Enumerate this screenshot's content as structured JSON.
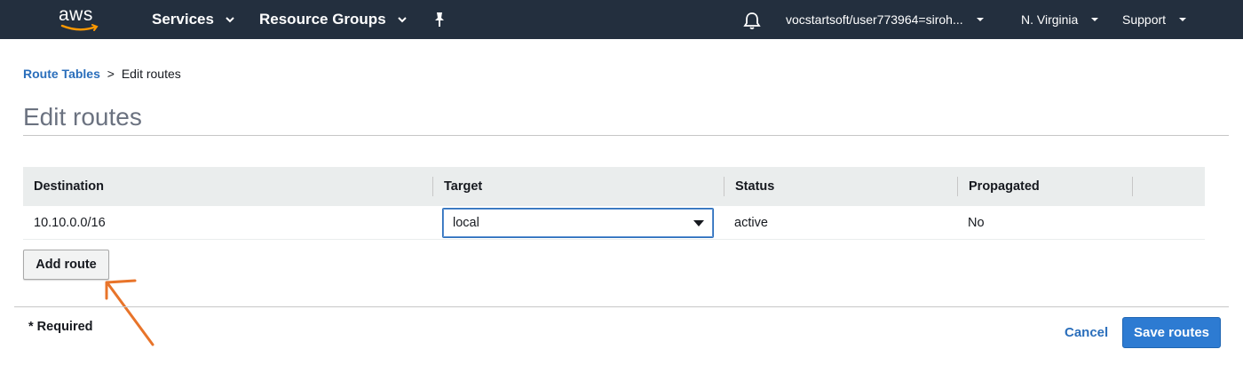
{
  "topbar": {
    "logo_text": "aws",
    "services_label": "Services",
    "resource_groups_label": "Resource Groups",
    "account_label": "vocstartsoft/user773964=siroh...",
    "region_label": "N. Virginia",
    "support_label": "Support"
  },
  "breadcrumb": {
    "parent_label": "Route Tables",
    "separator": ">",
    "current_label": "Edit routes"
  },
  "page": {
    "title": "Edit routes"
  },
  "table": {
    "columns": [
      "Destination",
      "Target",
      "Status",
      "Propagated"
    ],
    "rows": [
      {
        "destination": "10.10.0.0/16",
        "target": "local",
        "status": "active",
        "propagated": "No"
      }
    ]
  },
  "actions": {
    "add_route_label": "Add route",
    "required_note": "* Required",
    "cancel_label": "Cancel",
    "save_label": "Save routes"
  },
  "colors": {
    "topbar_bg": "#232f3e",
    "link": "#2a6ebb",
    "primary_button": "#2d7bd2",
    "annotation": "#e8742a"
  },
  "icons": [
    "aws-logo",
    "chevron-down-icon",
    "pin-icon",
    "bell-icon",
    "dropdown-caret-icon"
  ]
}
